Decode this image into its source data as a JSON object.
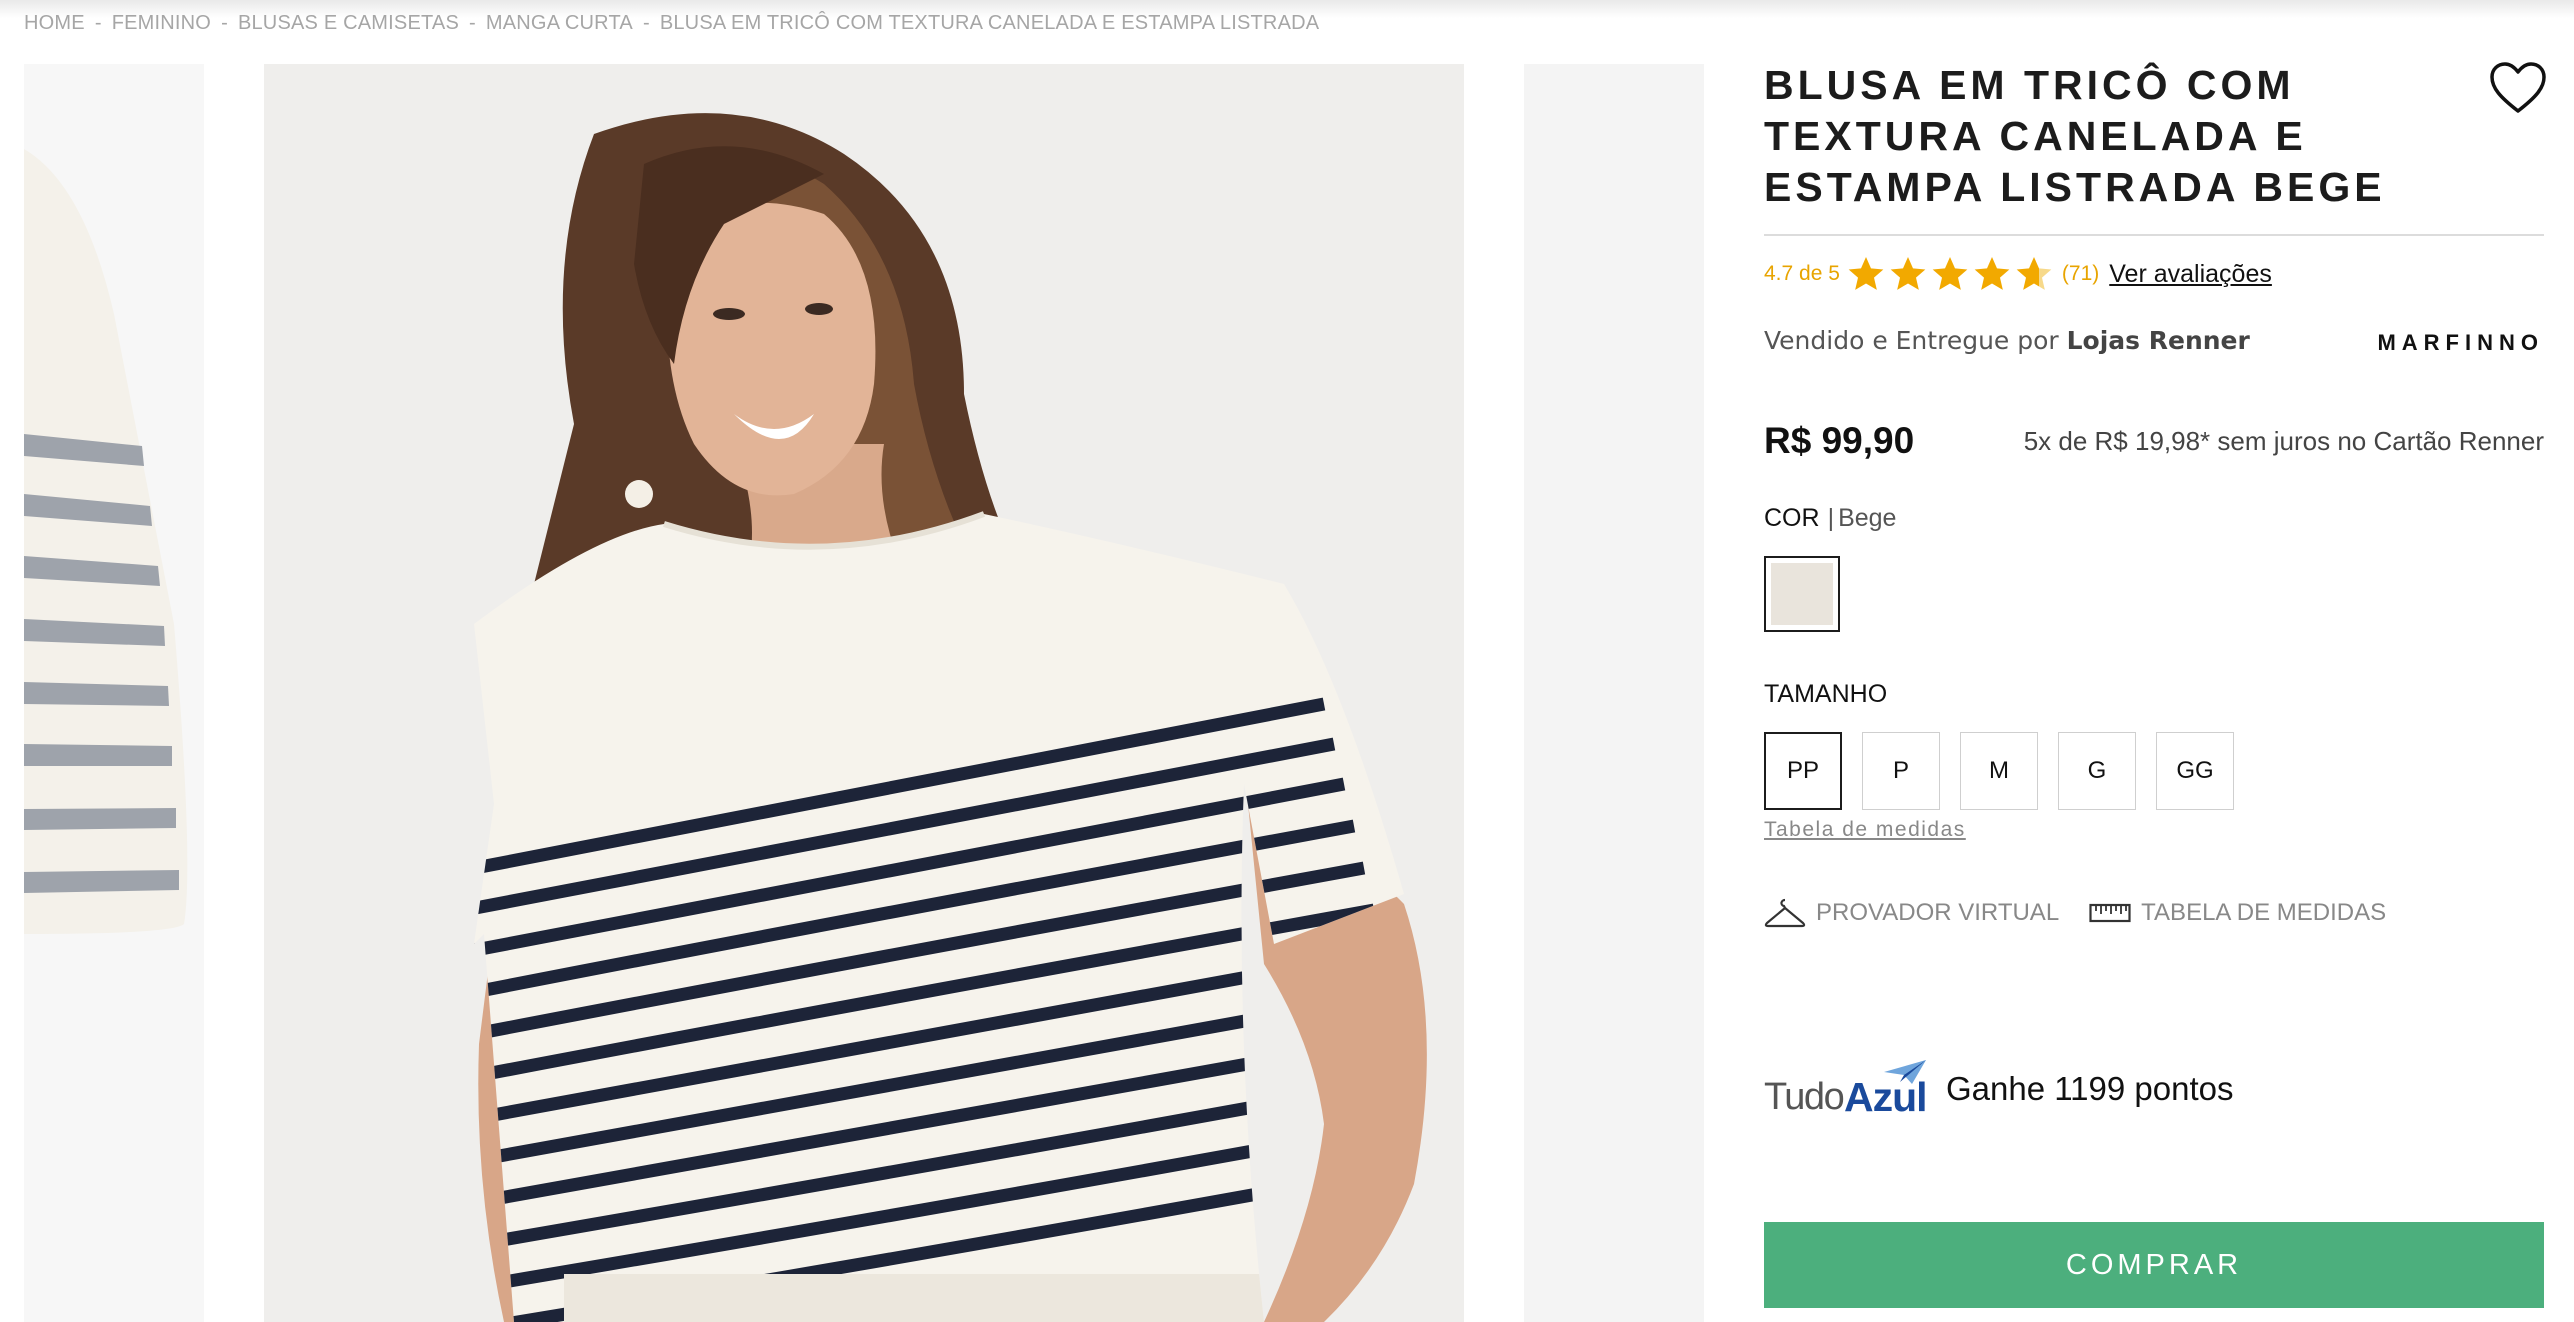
{
  "breadcrumb": {
    "items": [
      "HOME",
      "FEMININO",
      "BLUSAS E CAMISETAS",
      "MANGA CURTA",
      "BLUSA EM TRICÔ COM TEXTURA CANELADA E ESTAMPA LISTRADA"
    ],
    "separator": "-"
  },
  "product": {
    "title": "BLUSA EM TRICÔ COM TEXTURA CANELADA E ESTAMPA LISTRADA BEGE",
    "rating": {
      "score_text": "4.7 de 5",
      "value": 4.7,
      "max": 5,
      "count_text": "(71)",
      "link_label": "Ver avaliações"
    },
    "seller": {
      "prefix": "Vendido e Entregue por ",
      "name": "Lojas Renner"
    },
    "brand": "MARFINNO",
    "price": "R$ 99,90",
    "installments": "5x de R$ 19,98* sem juros no Cartão Renner",
    "color": {
      "label": "COR",
      "separator": "|",
      "value": "Bege",
      "swatch_hex": "#e9e4dc"
    },
    "size": {
      "label": "TAMANHO",
      "options": [
        "PP",
        "P",
        "M",
        "G",
        "GG"
      ],
      "selected": "PP",
      "table_link": "Tabela de medidas"
    },
    "tools": {
      "virtual_fitting": "PROVADOR VIRTUAL",
      "size_chart": "TABELA DE MEDIDAS"
    },
    "loyalty": {
      "logo_part1": "Tudo",
      "logo_part2": "Azul",
      "text": "Ganhe 1199 pontos"
    },
    "buy_label": "COMPRAR"
  },
  "colors": {
    "buy_button": "#4caf7d",
    "rating_gold": "#e8a400",
    "stripe_navy": "#1d2438",
    "knit_cream": "#f6f3ec"
  },
  "icons": [
    "heart-icon",
    "star-icon",
    "hanger-icon",
    "ruler-icon",
    "paper-plane-icon"
  ]
}
